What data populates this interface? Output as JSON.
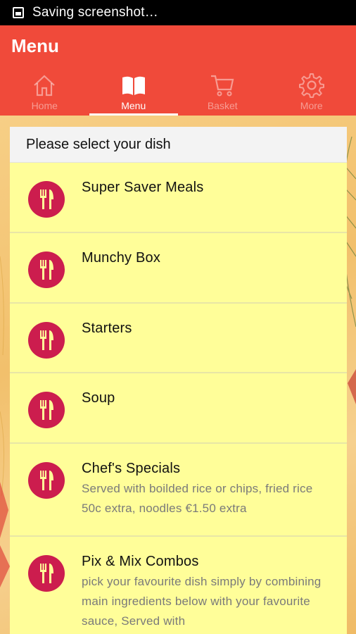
{
  "status_bar": {
    "text": "Saving screenshot…"
  },
  "app_bar": {
    "title": "Menu",
    "tabs": [
      {
        "label": "Home",
        "icon": "home-icon",
        "active": false
      },
      {
        "label": "Menu",
        "icon": "book-icon",
        "active": true
      },
      {
        "label": "Basket",
        "icon": "cart-icon",
        "active": false
      },
      {
        "label": "More",
        "icon": "gear-icon",
        "active": false
      }
    ]
  },
  "panel": {
    "header": "Please select your dish",
    "items": [
      {
        "name": "Super Saver Meals",
        "desc": ""
      },
      {
        "name": "Munchy Box",
        "desc": ""
      },
      {
        "name": "Starters",
        "desc": ""
      },
      {
        "name": "Soup",
        "desc": ""
      },
      {
        "name": "Chef's Specials",
        "desc": "Served with boilded rice or chips, fried rice 50c extra, noodles €1.50 extra"
      },
      {
        "name": "Pix & Mix Combos",
        "desc": "pick your favourite dish simply by combining main ingredients below with your favourite sauce, Served with"
      }
    ]
  },
  "colors": {
    "app_bar": "#f04a3a",
    "item_bg": "#fffe99",
    "badge": "#cc1d4e"
  }
}
